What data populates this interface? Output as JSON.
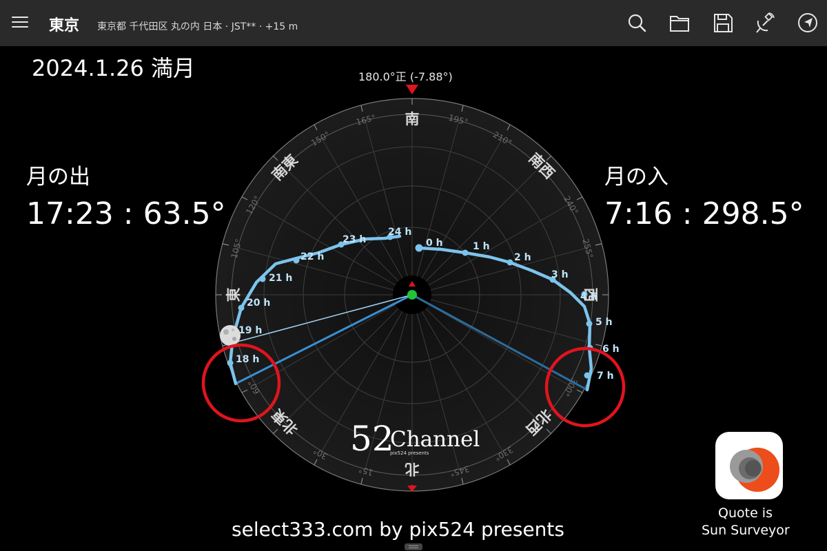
{
  "header": {
    "title": "東京",
    "subtitle": "東京都 千代田区 丸の内 日本 · JST** · +15 m",
    "icons": [
      "menu-icon",
      "search-icon",
      "folder-icon",
      "save-icon",
      "satellite-icon",
      "navigation-icon"
    ]
  },
  "event": {
    "date_label": "2024.1.26 満月"
  },
  "moonrise": {
    "title": "月の出",
    "value": "17:23 : 63.5°"
  },
  "moonset": {
    "title": "月の入",
    "value": "7:16 : 298.5°"
  },
  "compass": {
    "top_readout": "180.0°正 (-7.88°)",
    "directions": {
      "south": "南",
      "southwest": "南西",
      "west": "西",
      "northwest": "北西",
      "north": "北",
      "northeast": "北東",
      "east": "東",
      "southeast": "南東"
    },
    "degree_labels": [
      "165°",
      "195°",
      "210°",
      "240°",
      "255°",
      "150°",
      "120°",
      "105°",
      "60°",
      "30°",
      "15°",
      "345°",
      "330°",
      "300°"
    ],
    "hour_labels": [
      "24 h",
      "0 h",
      "1 h",
      "2 h",
      "3 h",
      "4 h",
      "5 h",
      "6 h",
      "7 h",
      "23 h",
      "22 h",
      "21 h",
      "20 h",
      "19 h",
      "18 h"
    ],
    "colors": {
      "path": "#7cc4ec",
      "line_rise": "#3a8fd0",
      "line_set": "#2a6e9e",
      "highlight": "#e0141e",
      "observer": "#22c33a"
    }
  },
  "branding": {
    "logo_number": "52",
    "logo_word": "Channel",
    "logo_tagline": "pix524 presents",
    "quote_line1": "Quote is",
    "quote_line2": "Sun Surveyor",
    "footer": "select333.com by pix524 presents"
  }
}
